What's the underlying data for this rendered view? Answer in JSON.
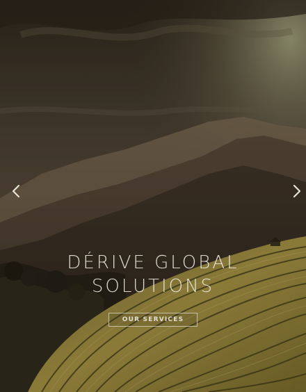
{
  "hero": {
    "headline_line_1": "DÉRIVE GLOBAL",
    "headline_line_2": "SOLUTIONS",
    "cta_label": "OUR SERVICES"
  },
  "carousel": {
    "prev_icon": "chevron-left-icon",
    "next_icon": "chevron-right-icon"
  },
  "colors": {
    "sky_top": "#3a3124",
    "sky_glow": "#8d8a68",
    "mountain_far": "#6f5f4a",
    "mountain_mid": "#4a3e2f",
    "terrace_light": "#b8a54e",
    "terrace_dark": "#4f4a22",
    "text": "#ece8de"
  }
}
